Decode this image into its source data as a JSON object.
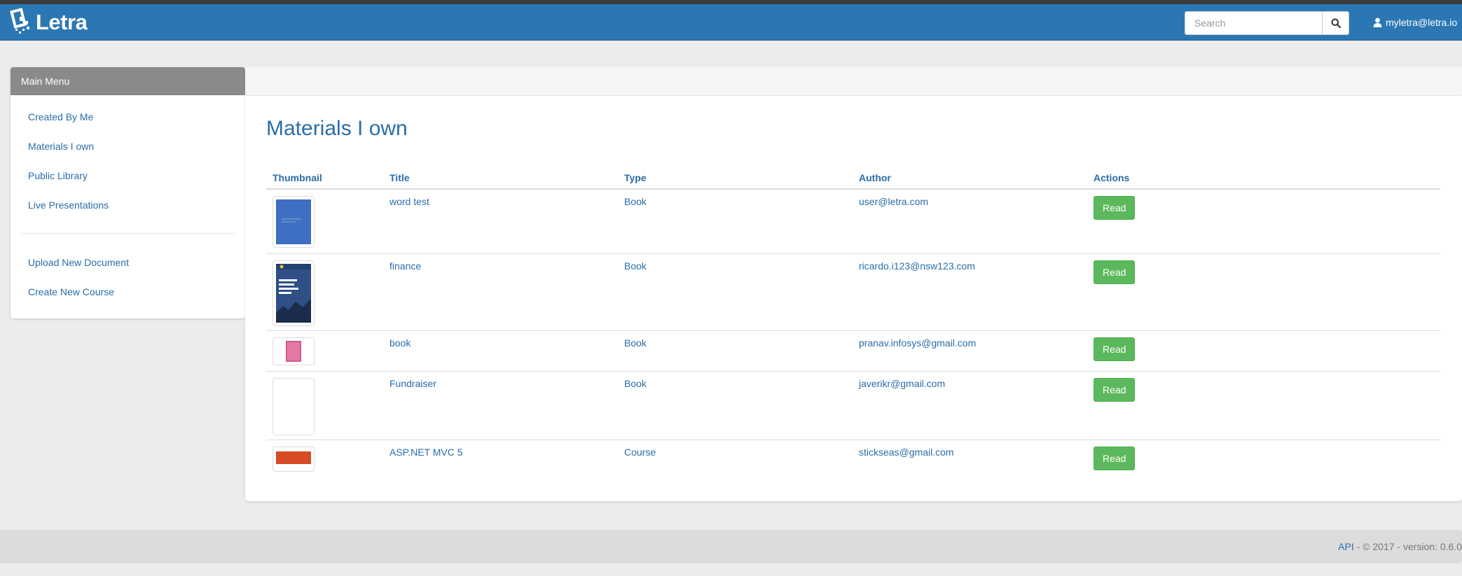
{
  "navbar": {
    "brand": "Letra",
    "search_placeholder": "Search",
    "search_icon": "search-icon",
    "user_icon": "user-icon",
    "user_email": "myletra@letra.io"
  },
  "sidebar": {
    "heading": "Main Menu",
    "items": [
      {
        "label": "Created By Me"
      },
      {
        "label": "Materials I own"
      },
      {
        "label": "Public Library"
      },
      {
        "label": "Live Presentations"
      }
    ],
    "actions": [
      {
        "label": "Upload New Document"
      },
      {
        "label": "Create New Course"
      }
    ]
  },
  "main": {
    "title": "Materials I own",
    "columns": [
      "Thumbnail",
      "Title",
      "Type",
      "Author",
      "Actions"
    ],
    "rows": [
      {
        "title": "word test",
        "type": "Book",
        "author": "user@letra.com",
        "action": "Read"
      },
      {
        "title": "finance",
        "type": "Book",
        "author": "ricardo.i123@nsw123.com",
        "action": "Read"
      },
      {
        "title": "book",
        "type": "Book",
        "author": "pranav.infosys@gmail.com",
        "action": "Read"
      },
      {
        "title": "Fundraiser",
        "type": "Book",
        "author": "javerikr@gmail.com",
        "action": "Read"
      },
      {
        "title": "ASP.NET MVC 5",
        "type": "Course",
        "author": "stickseas@gmail.com",
        "action": "Read"
      }
    ]
  },
  "footer": {
    "api_link": "API",
    "text": " - © 2017 - version: 0.6.0"
  },
  "colors": {
    "navbar": "#2b77b3",
    "link": "#2a6da8",
    "read_button": "#5cb85c",
    "menu_header": "#8a8a8a"
  }
}
